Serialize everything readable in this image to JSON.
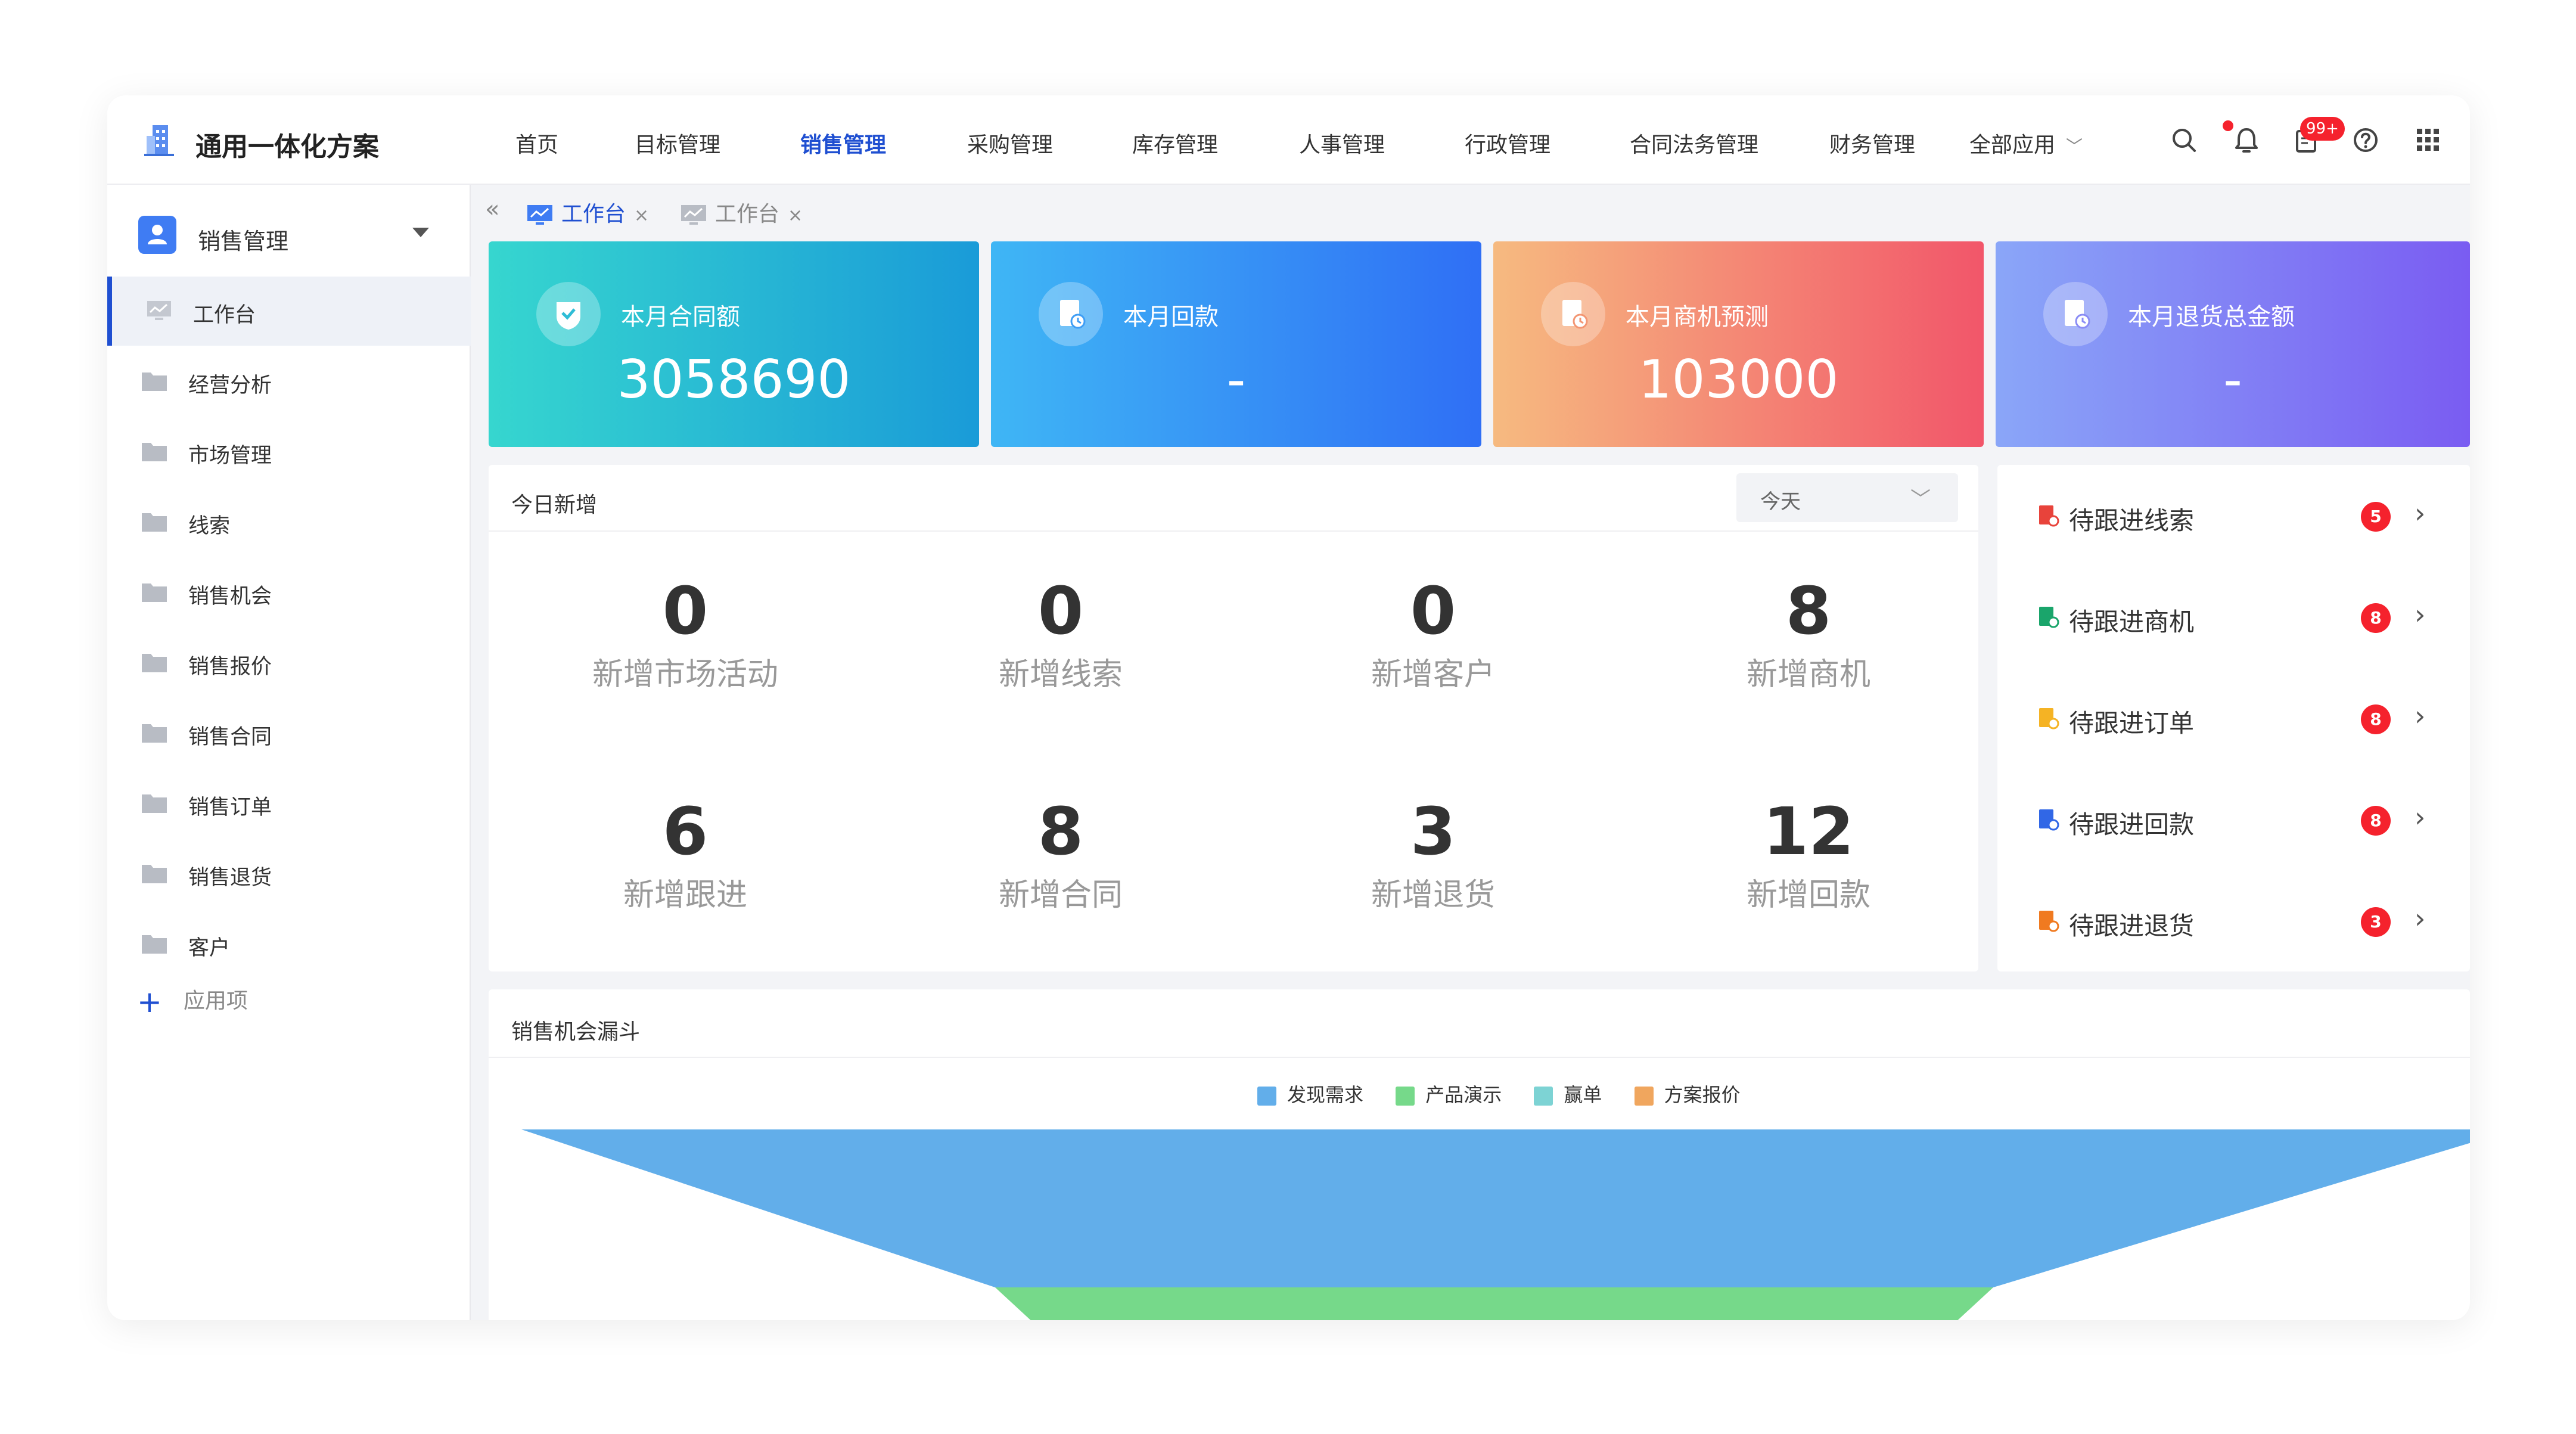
{
  "app": {
    "title": "通用一体化方案"
  },
  "topnav": [
    {
      "label": "首页",
      "active": false
    },
    {
      "label": "目标管理",
      "active": false
    },
    {
      "label": "销售管理",
      "active": true
    },
    {
      "label": "采购管理",
      "active": false
    },
    {
      "label": "库存管理",
      "active": false
    },
    {
      "label": "人事管理",
      "active": false
    },
    {
      "label": "行政管理",
      "active": false
    },
    {
      "label": "合同法务管理",
      "active": false
    },
    {
      "label": "财务管理",
      "active": false
    },
    {
      "label": "全部应用",
      "active": false
    }
  ],
  "topicons": {
    "search": "search-icon",
    "bell": "bell-icon",
    "tasks": "clipboard-icon",
    "tasks_badge": "99+",
    "help": "help-icon",
    "apps": "grid-icon"
  },
  "sidebar": {
    "header": "销售管理",
    "items": [
      {
        "label": "工作台",
        "active": true
      },
      {
        "label": "经营分析"
      },
      {
        "label": "市场管理"
      },
      {
        "label": "线索"
      },
      {
        "label": "销售机会"
      },
      {
        "label": "销售报价"
      },
      {
        "label": "销售合同"
      },
      {
        "label": "销售订单"
      },
      {
        "label": "销售退货"
      },
      {
        "label": "客户"
      }
    ],
    "add_label": "应用项"
  },
  "tabs": [
    {
      "label": "工作台",
      "active": true
    },
    {
      "label": "工作台",
      "active": false
    }
  ],
  "cards": [
    {
      "title": "本月合同额",
      "value": "3058690",
      "gradient": [
        "#36d6cf",
        "#1a9bd8"
      ]
    },
    {
      "title": "本月回款",
      "value": "-",
      "gradient": [
        "#3fb6f5",
        "#2f6ff5"
      ]
    },
    {
      "title": "本月商机预测",
      "value": "103000",
      "gradient": [
        "#f6ba80",
        "#f2566a"
      ]
    },
    {
      "title": "本月退货总金额",
      "value": "-",
      "gradient": [
        "#8aa6f8",
        "#7a5cf2"
      ]
    }
  ],
  "today": {
    "title": "今日新增",
    "select": "今天",
    "metrics": [
      {
        "value": "0",
        "label": "新增市场活动"
      },
      {
        "value": "0",
        "label": "新增线索"
      },
      {
        "value": "0",
        "label": "新增客户"
      },
      {
        "value": "8",
        "label": "新增商机"
      },
      {
        "value": "6",
        "label": "新增跟进"
      },
      {
        "value": "8",
        "label": "新增合同"
      },
      {
        "value": "3",
        "label": "新增退货"
      },
      {
        "value": "12",
        "label": "新增回款"
      }
    ]
  },
  "follow": [
    {
      "label": "待跟进线索",
      "count": "5",
      "color": "#e8433b"
    },
    {
      "label": "待跟进商机",
      "count": "8",
      "color": "#1aa56b"
    },
    {
      "label": "待跟进订单",
      "count": "8",
      "color": "#f5b324"
    },
    {
      "label": "待跟进回款",
      "count": "8",
      "color": "#3167e6"
    },
    {
      "label": "待跟进退货",
      "count": "3",
      "color": "#f07a20"
    }
  ],
  "funnel": {
    "title": "销售机会漏斗",
    "legend": [
      {
        "label": "发现需求",
        "color": "#62aeea"
      },
      {
        "label": "产品演示",
        "color": "#76d98a"
      },
      {
        "label": "赢单",
        "color": "#7dd3d4"
      },
      {
        "label": "方案报价",
        "color": "#f0a65e"
      }
    ]
  }
}
